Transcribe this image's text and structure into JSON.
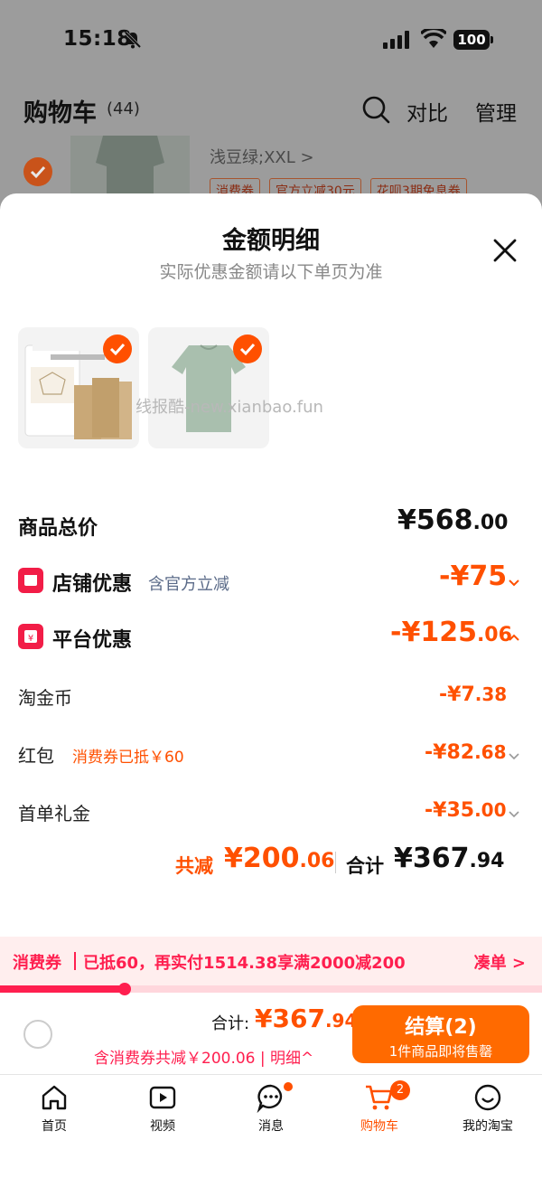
{
  "status_bar": {
    "time": "15:18",
    "battery": "100"
  },
  "header": {
    "title": "购物车",
    "count": "(44)",
    "compare": "对比",
    "manage": "管理"
  },
  "background_item": {
    "spec": "浅豆绿;XXL >",
    "tags": [
      "消费券",
      "官方立减30元",
      "花呗3期免息券"
    ]
  },
  "sheet": {
    "title": "金额明细",
    "subtitle": "实际优惠金额请以下单页为准",
    "total_price": {
      "label": "商品总价",
      "int": "¥568",
      "dec": ".00"
    },
    "store_discount": {
      "label": "店铺优惠",
      "note": "含官方立减",
      "int": "-¥75",
      "dec": ""
    },
    "platform_discount": {
      "label": "平台优惠",
      "int": "-¥125",
      "dec": ".06"
    },
    "taojinbi": {
      "label": "淘金币",
      "int": "-¥7",
      "dec": ".38"
    },
    "hongbao": {
      "label": "红包",
      "note": "消费券已抵￥60",
      "int": "-¥82",
      "dec": ".68"
    },
    "first_gift": {
      "label": "首单礼金",
      "int": "-¥35",
      "dec": ".00"
    },
    "summary": {
      "reduce_label": "共减",
      "reduce_int": "¥200",
      "reduce_dec": ".06",
      "total_label": "合计",
      "total_int": "¥367",
      "total_dec": ".94"
    }
  },
  "watermark": "线报酷-new.xianbao.fun",
  "coupon_bar": {
    "label": "消费券",
    "text": "已抵60，再实付1514.38享满2000减200",
    "link": "凑单 >",
    "progress": 0.23
  },
  "checkout": {
    "total_label": "合计:",
    "total_int": "¥367",
    "total_dec": ".94",
    "detail": "含消费券共减￥200.06 | 明细^",
    "button_label": "结算(2)",
    "button_sub": "1件商品即将售罄"
  },
  "tabbar": {
    "home": "首页",
    "video": "视频",
    "messages": "消息",
    "cart": "购物车",
    "cart_badge": "2",
    "me": "我的淘宝"
  },
  "colors": {
    "accent": "#ff5000",
    "coupon": "#ff1f4f"
  }
}
